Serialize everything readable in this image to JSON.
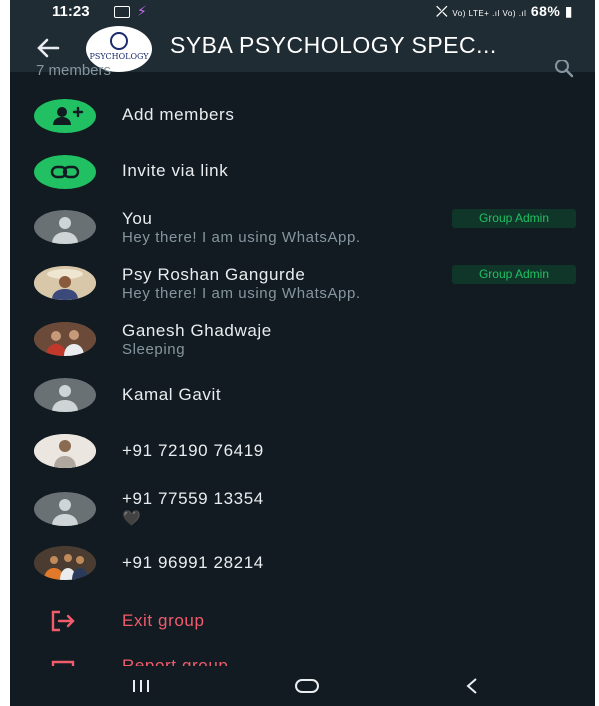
{
  "status_bar": {
    "time": "11:23",
    "signal_text": "Vo) LTE+ .ıl Vo) .ıl",
    "battery": "68%"
  },
  "header": {
    "group_name": "SYBA PSYCHOLOGY SPEC...",
    "avatar_text": "PSYCHOLOGY"
  },
  "members_count": "7 members",
  "actions": {
    "add_members": "Add members",
    "invite_link": "Invite via link"
  },
  "members": [
    {
      "name": "You",
      "status": "Hey there! I am using WhatsApp.",
      "badge": "Group Admin"
    },
    {
      "name": "Psy Roshan Gangurde",
      "status": "Hey there! I am using WhatsApp.",
      "badge": "Group Admin"
    },
    {
      "name": "Ganesh Ghadwaje",
      "status": "Sleeping"
    },
    {
      "name": "Kamal Gavit"
    },
    {
      "name": "+91 72190 76419"
    },
    {
      "name": "+91 77559 13354",
      "status": "🖤"
    },
    {
      "name": "+91 96991 28214"
    }
  ],
  "footer_actions": {
    "exit_group": "Exit group",
    "report_group": "Report group"
  },
  "colors": {
    "background": "#111b21",
    "accent_green": "#21c063",
    "exit_red": "#f15c6d"
  }
}
